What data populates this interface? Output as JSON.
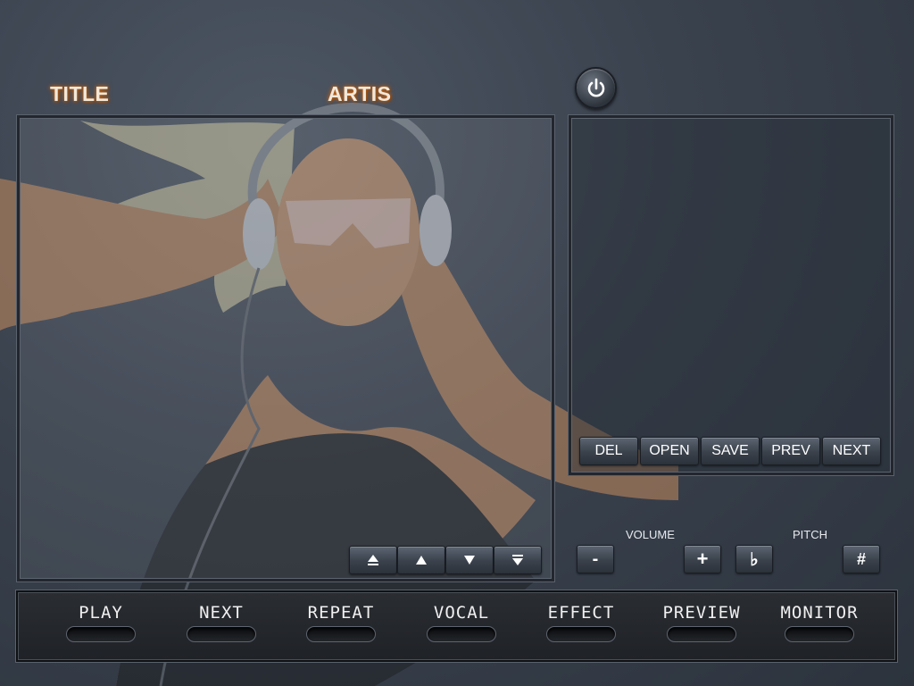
{
  "header": {
    "title_label": "TITLE",
    "artist_label": "ARTIS"
  },
  "power": {
    "icon": "power-icon"
  },
  "list_controls": {
    "top_icon": "move-top-icon",
    "up_icon": "move-up-icon",
    "down_icon": "move-down-icon",
    "bottom_icon": "move-bottom-icon"
  },
  "playlist_buttons": [
    "DEL",
    "OPEN",
    "SAVE",
    "PREV",
    "NEXT"
  ],
  "volume": {
    "label": "VOLUME",
    "minus": "-",
    "plus": "+"
  },
  "pitch": {
    "label": "PITCH",
    "flat": "♭",
    "sharp": "#"
  },
  "bottom_bar": [
    "PLAY",
    "NEXT",
    "REPEAT",
    "VOCAL",
    "EFFECT",
    "PREVIEW",
    "MONITOR"
  ],
  "colors": {
    "title_glow": "#c86a1f",
    "background": "#3a424e",
    "button": "#3a414b"
  }
}
